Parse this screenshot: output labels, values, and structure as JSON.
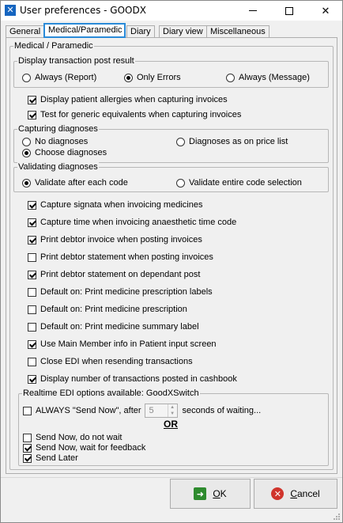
{
  "window": {
    "title": "User preferences - GOODX",
    "icon": "goodx-app-icon"
  },
  "tabs": [
    {
      "label": "General",
      "active": false
    },
    {
      "label": "Medical/Paramedic",
      "active": true
    },
    {
      "label": "Diary",
      "active": false
    },
    {
      "label": "Diary view",
      "active": false
    },
    {
      "label": "Miscellaneous",
      "active": false
    }
  ],
  "main": {
    "section_title": "Medical / Paramedic",
    "post_result": {
      "legend": "Display transaction post result",
      "options": [
        {
          "label": "Always (Report)",
          "checked": false
        },
        {
          "label": "Only Errors",
          "checked": true
        },
        {
          "label": "Always (Message)",
          "checked": false
        }
      ]
    },
    "checks_a": [
      {
        "label": "Display patient allergies when capturing invoices",
        "checked": true
      },
      {
        "label": "Test for generic equivalents when capturing invoices",
        "checked": true
      }
    ],
    "diagnoses": {
      "legend": "Capturing diagnoses",
      "options": [
        {
          "label": "No diagnoses",
          "checked": false
        },
        {
          "label": "Diagnoses as on price list",
          "checked": false
        },
        {
          "label": "Choose diagnoses",
          "checked": true
        }
      ]
    },
    "validating": {
      "legend": "Validating diagnoses",
      "options": [
        {
          "label": "Validate after each code",
          "checked": true
        },
        {
          "label": "Validate entire code selection",
          "checked": false
        }
      ]
    },
    "checks_b": [
      {
        "label": "Capture signata when invoicing medicines",
        "checked": true
      },
      {
        "label": "Capture time when invoicing anaesthetic time code",
        "checked": true
      },
      {
        "label": "Print debtor invoice when posting invoices",
        "checked": true
      },
      {
        "label": "Print debtor statement when posting invoices",
        "checked": false
      },
      {
        "label": "Print debtor statement on dependant post",
        "checked": true
      },
      {
        "label": "Default on: Print medicine prescription labels",
        "checked": false
      },
      {
        "label": "Default on: Print medicine prescription",
        "checked": false
      },
      {
        "label": "Default on: Print medicine summary label",
        "checked": false
      },
      {
        "label": "Use Main Member info in Patient input screen",
        "checked": true
      },
      {
        "label": "Close EDI when resending transactions",
        "checked": false
      },
      {
        "label": "Display number of transactions posted in cashbook",
        "checked": true
      }
    ],
    "realtime": {
      "legend": "Realtime EDI options available: GoodXSwitch",
      "always_label": "ALWAYS \"Send Now\", after",
      "always_checked": false,
      "seconds_value": "5",
      "seconds_suffix": "seconds of waiting...",
      "or_label": "OR",
      "options": [
        {
          "label": "Send Now, do not wait",
          "checked": false
        },
        {
          "label": "Send Now, wait for feedback",
          "checked": true
        },
        {
          "label": "Send Later",
          "checked": true
        }
      ]
    }
  },
  "buttons": {
    "ok_label": "OK",
    "cancel_label": "Cancel"
  },
  "colors": {
    "active_tab_border": "#2a8ad8",
    "ok_icon": "#2e8b2e",
    "cancel_icon": "#d0342c"
  }
}
